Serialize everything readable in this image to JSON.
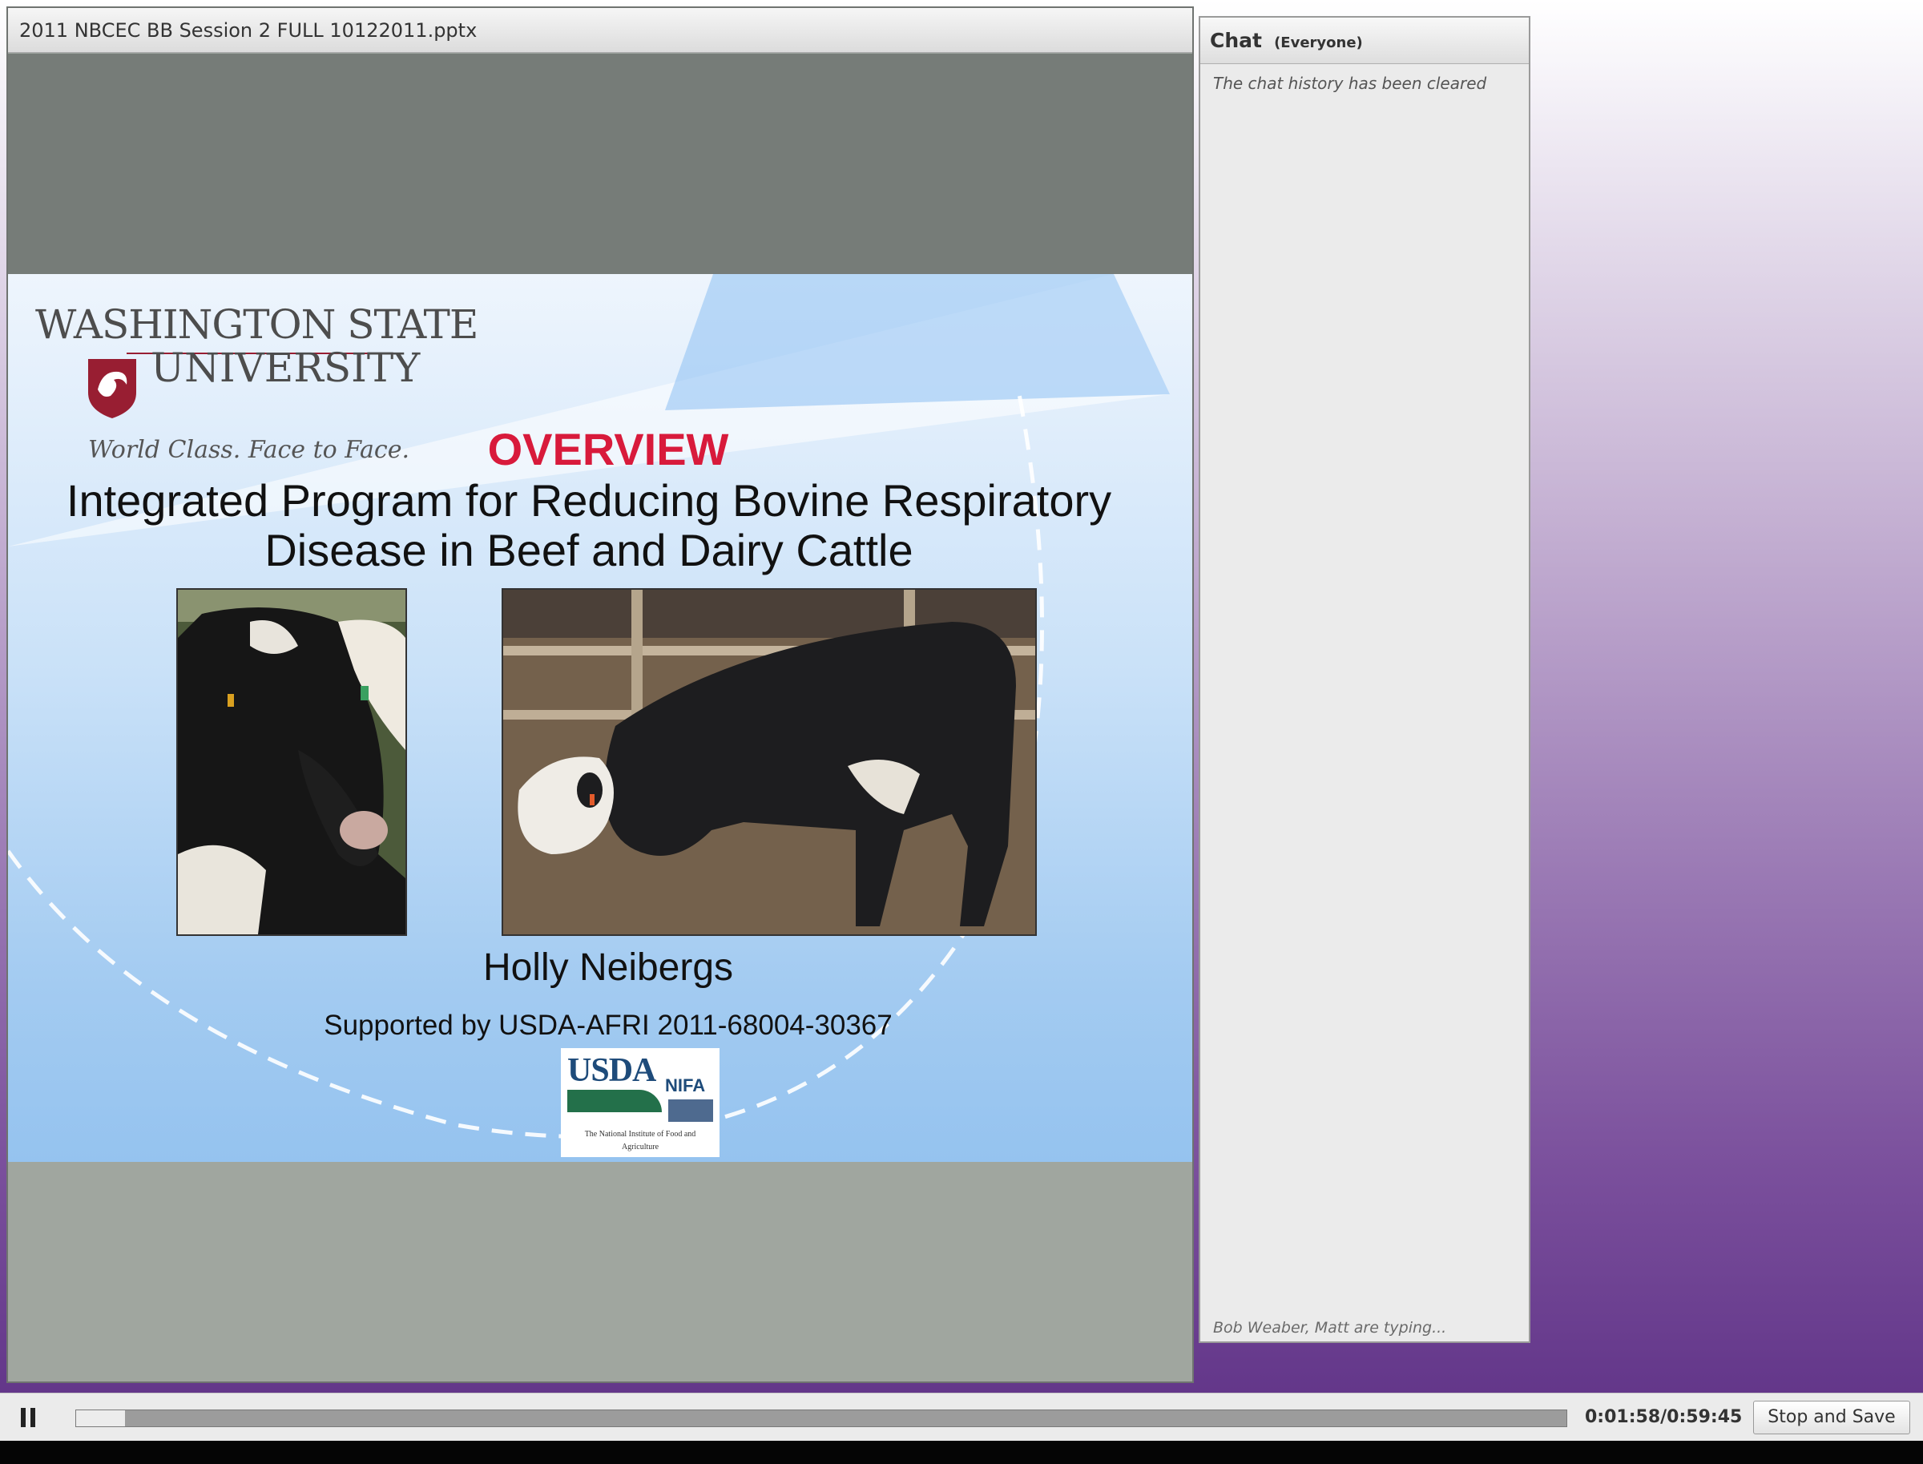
{
  "presentation": {
    "file_name": "2011 NBCEC BB Session 2 FULL 10122011.pptx",
    "slide": {
      "logo_line1": "WASHINGTON STATE",
      "logo_line2": "UNIVERSITY",
      "logo_tagline": "World Class. Face to Face.",
      "heading": "OVERVIEW",
      "title": "Integrated Program for Reducing Bovine Respiratory Disease in Beef and Dairy Cattle",
      "presenter": "Holly Neibergs",
      "support": "Supported by USDA-AFRI 2011-68004-30367",
      "usda_logo": {
        "usda": "USDA",
        "nifa": "NIFA",
        "subtitle": "The National Institute of Food and Agriculture"
      },
      "colors": {
        "heading": "#d81a3b",
        "wsu_crimson": "#981e32"
      }
    }
  },
  "chat": {
    "title": "Chat",
    "scope": "(Everyone)",
    "history_message": "The chat history has been cleared",
    "typing_status": "Bob Weaber, Matt are typing..."
  },
  "playback": {
    "elapsed": "0:01:58",
    "total": "0:59:45",
    "time_display": "0:01:58/0:59:45",
    "progress_fraction": 0.033,
    "stop_label": "Stop and Save",
    "pause_icon": "pause-icon"
  }
}
